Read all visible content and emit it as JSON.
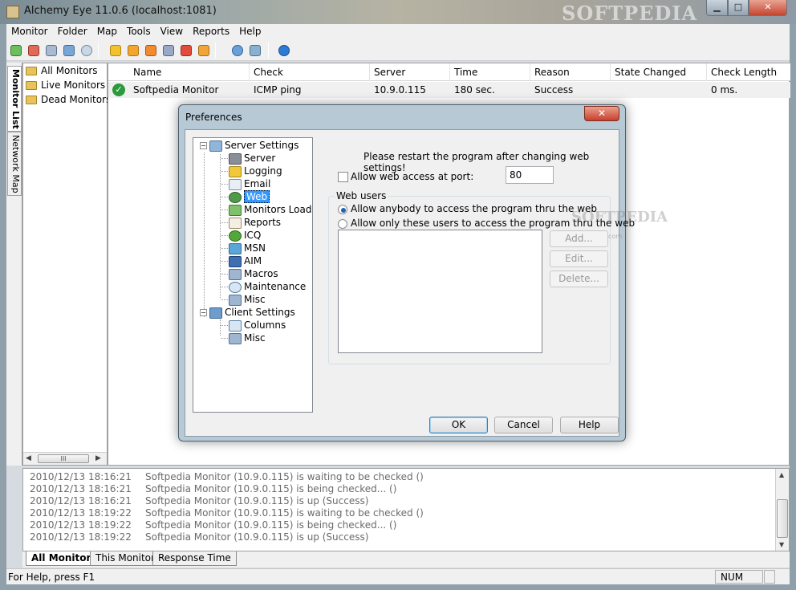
{
  "window": {
    "title": "Alchemy Eye 11.0.6 (localhost:1081)",
    "watermark": "SOFTPEDIA",
    "min_glyph": "▁",
    "max_glyph": "□",
    "close_glyph": "✕"
  },
  "menu": [
    "Monitor",
    "Folder",
    "Map",
    "Tools",
    "View",
    "Reports",
    "Help"
  ],
  "side_tabs": [
    "Monitor List",
    "Network Map"
  ],
  "sidebar": {
    "items": [
      "All Monitors",
      "Live Monitors",
      "Dead Monitors"
    ],
    "scroll_thumb": "III"
  },
  "table": {
    "columns": [
      "Name",
      "Check",
      "Server",
      "Time",
      "Reason",
      "State Changed",
      "Check Length"
    ],
    "rows": [
      {
        "name": "Softpedia Monitor",
        "check": "ICMP ping",
        "server": "10.9.0.115",
        "time": "180 sec.",
        "reason": "Success",
        "state_changed": "",
        "check_length": "0 ms."
      }
    ]
  },
  "log": [
    {
      "ts": "2010/12/13 18:16:21",
      "msg": "Softpedia Monitor (10.9.0.115) is waiting to be checked ()"
    },
    {
      "ts": "2010/12/13 18:16:21",
      "msg": "Softpedia Monitor (10.9.0.115) is being checked... ()"
    },
    {
      "ts": "2010/12/13 18:16:21",
      "msg": "Softpedia Monitor (10.9.0.115) is up (Success)"
    },
    {
      "ts": "2010/12/13 18:19:22",
      "msg": "Softpedia Monitor (10.9.0.115) is waiting to be checked ()"
    },
    {
      "ts": "2010/12/13 18:19:22",
      "msg": "Softpedia Monitor (10.9.0.115) is being checked... ()"
    },
    {
      "ts": "2010/12/13 18:19:22",
      "msg": "Softpedia Monitor (10.9.0.115) is up (Success)"
    }
  ],
  "log_tabs": [
    "All Monitors",
    "This Monitor",
    "Response Time"
  ],
  "status": {
    "help": "For Help, press F1",
    "num": "NUM"
  },
  "dialog": {
    "title": "Preferences",
    "close_glyph": "✕",
    "tree": {
      "server_settings": "Server Settings",
      "server_children": [
        "Server",
        "Logging",
        "Email",
        "Web",
        "Monitors Load",
        "Reports",
        "ICQ",
        "MSN",
        "AIM",
        "Macros",
        "Maintenance",
        "Misc"
      ],
      "client_settings": "Client Settings",
      "client_children": [
        "Columns",
        "Misc"
      ],
      "selected": "Web"
    },
    "web": {
      "restart_note": "Please restart the program after changing web settings!",
      "allow_access_label": "Allow web access at port:",
      "allow_access_checked": false,
      "port": "80",
      "group_label": "Web users",
      "radio_anybody": "Allow anybody to access the program thru the web",
      "radio_only": "Allow only these users to access the program thru the web",
      "selected_radio": "anybody",
      "add_label": "Add...",
      "edit_label": "Edit...",
      "delete_label": "Delete...",
      "watermark": "SOFTPEDIA",
      "watermark_url": "www.softpedia.com"
    },
    "ok_label": "OK",
    "cancel_label": "Cancel",
    "help_label": "Help"
  },
  "colors": {
    "accent": "#3399ff",
    "success": "#2b9a3c",
    "close_red": "#c6402b"
  }
}
